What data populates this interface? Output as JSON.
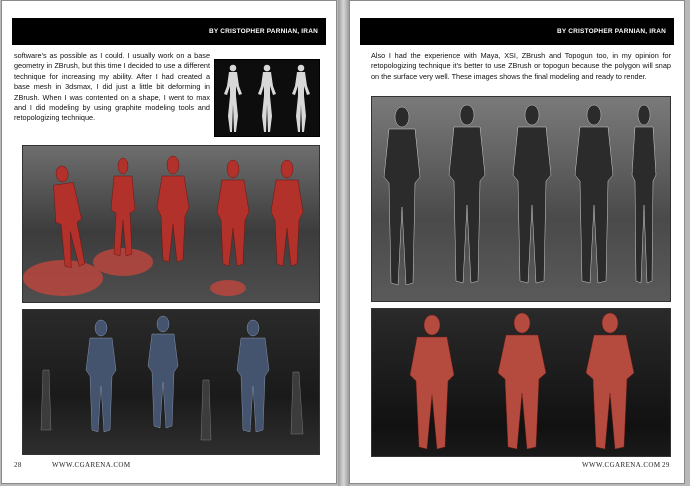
{
  "spread": {
    "left_page": {
      "header": "BY CRISTOPHER PARNIAN, IRAN",
      "body_text": "software's as possible as I could. I usually work on a base geometry in ZBrush, but this time I decided to use a different technique for increasing my ability. After I had created a base mesh in 3dsmax, I did just a little bit deforming in ZBrush. When I was contented on a shape, I went to max and I did modeling by using graphite modeling tools and retopologizing technique.",
      "page_number": "28",
      "website": "WWW.CGARENA.COM",
      "images": [
        {
          "name": "base-mesh-render",
          "figures": 3,
          "color": "#d9d9d9"
        },
        {
          "name": "red-clay-renders",
          "figures": 5,
          "color": "#b0322c"
        },
        {
          "name": "blue-wireframe-renders",
          "figures": 6,
          "color": "#4a5a7a"
        }
      ]
    },
    "right_page": {
      "header": "BY CRISTOPHER PARNIAN, IRAN",
      "body_text": "Also I had the experience with Maya, XSI, ZBrush and Topogun too, in my opinion for retopologizing technique it's better to use ZBrush or topogun because the polygon will snap on the surface very well. These images shows the final modeling and ready to render.",
      "page_number": "29",
      "website": "WWW.CGARENA.COM",
      "images": [
        {
          "name": "final-model-wire-renders",
          "figures": 5,
          "color": "#8a8a8a"
        },
        {
          "name": "final-model-red-renders",
          "figures": 3,
          "color": "#b54a3e"
        }
      ]
    }
  }
}
